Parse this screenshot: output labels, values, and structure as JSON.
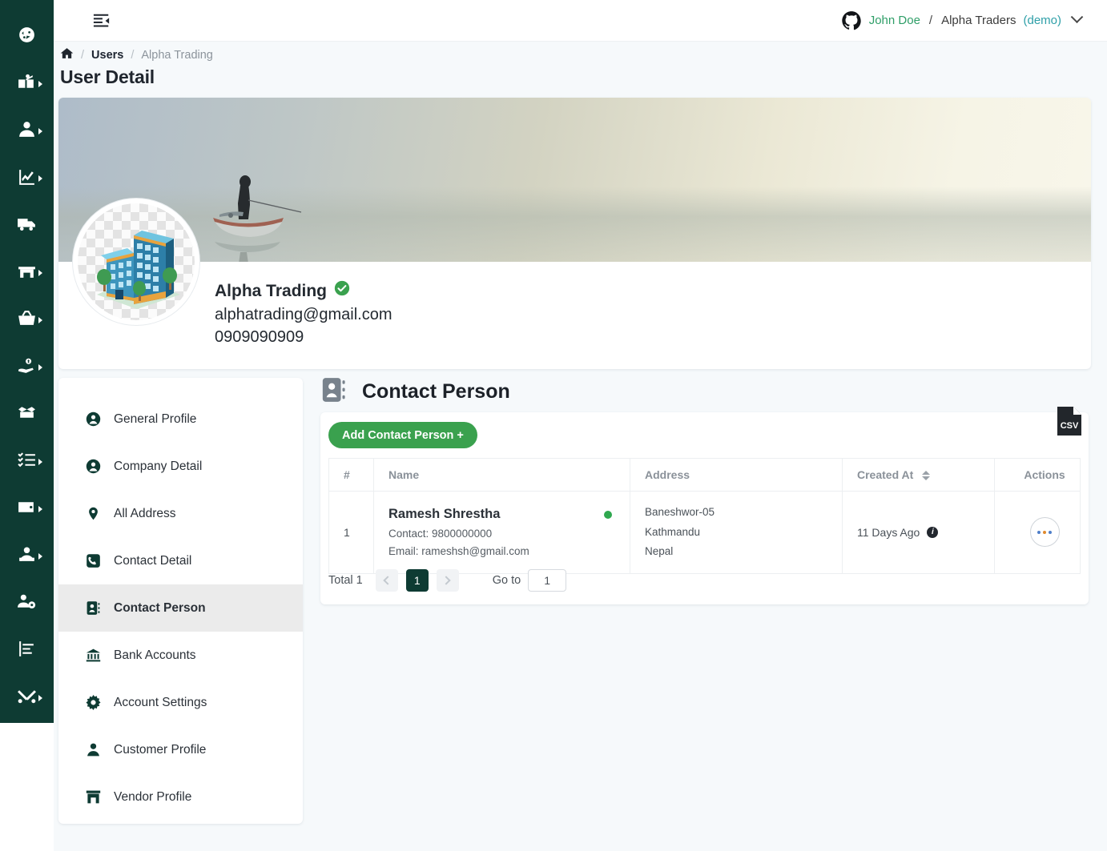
{
  "sidebar": {
    "items": [
      {
        "icon": "dashboard-icon",
        "caret": false
      },
      {
        "icon": "book-reader-icon",
        "caret": true
      },
      {
        "icon": "user-icon",
        "caret": true
      },
      {
        "icon": "chart-line-icon",
        "caret": true
      },
      {
        "icon": "truck-icon",
        "caret": false
      },
      {
        "icon": "store-icon",
        "caret": true
      },
      {
        "icon": "basket-icon",
        "caret": true
      },
      {
        "icon": "hand-money-icon",
        "caret": true
      },
      {
        "icon": "box-open-icon",
        "caret": false
      },
      {
        "icon": "task-list-icon",
        "caret": true
      },
      {
        "icon": "wallet-icon",
        "caret": true
      },
      {
        "icon": "users-group-icon",
        "caret": true
      },
      {
        "icon": "user-cog-icon",
        "caret": false
      },
      {
        "icon": "bar-report-icon",
        "caret": false
      },
      {
        "icon": "tools-icon",
        "caret": true
      }
    ]
  },
  "topbar": {
    "toggle_icon": "sidebar-collapse-icon",
    "account_icon": "github-avatar-icon",
    "user_name": "John Doe",
    "separator": "/",
    "org_name": "Alpha Traders",
    "org_mode": "(demo)",
    "dropdown_icon": "chevron-down-icon"
  },
  "breadcrumb": {
    "home_icon": "home-icon",
    "sep": "/",
    "items": [
      {
        "label": "Users",
        "current": false
      },
      {
        "label": "Alpha Trading",
        "current": true
      }
    ]
  },
  "page": {
    "title": "User Detail"
  },
  "profile": {
    "cover_alt": "fisherman-on-lake-cover",
    "avatar_alt": "company-building-avatar",
    "name": "Alpha Trading",
    "verified_icon": "verified-check-icon",
    "email": "alphatrading@gmail.com",
    "phone": "0909090909"
  },
  "menu": {
    "items": [
      {
        "label": "General Profile",
        "icon": "user-circle-icon",
        "active": false
      },
      {
        "label": "Company Detail",
        "icon": "user-circle-icon",
        "active": false
      },
      {
        "label": "All Address",
        "icon": "map-pin-icon",
        "active": false
      },
      {
        "label": "Contact Detail",
        "icon": "phone-square-icon",
        "active": false
      },
      {
        "label": "Contact Person",
        "icon": "address-book-icon",
        "active": true
      },
      {
        "label": "Bank Accounts",
        "icon": "bank-icon",
        "active": false
      },
      {
        "label": "Account Settings",
        "icon": "gear-icon",
        "active": false
      },
      {
        "label": "Customer Profile",
        "icon": "person-icon",
        "active": false
      },
      {
        "label": "Vendor Profile",
        "icon": "store-front-icon",
        "active": false
      }
    ]
  },
  "panel": {
    "icon": "address-book-icon",
    "title": "Contact Person",
    "add_button": "Add Contact Person +",
    "export_icon": "csv-file-icon",
    "columns": [
      "#",
      "Name",
      "Address",
      "Created At",
      "Actions"
    ],
    "sort_column": "Created At",
    "sort_icon": "sort-updown-icon",
    "rows": [
      {
        "index": "1",
        "name": "Ramesh Shrestha",
        "status_icon": "status-dot-active",
        "contact": "Contact: 9800000000",
        "email": "Email: rameshsh@gmail.com",
        "address_line1": "Baneshwor-05",
        "address_line2": "Kathmandu",
        "address_line3": "Nepal",
        "created_at": "11 Days Ago",
        "created_info_icon": "info-icon",
        "action_icon": "ellipsis-icon"
      }
    ],
    "pagination": {
      "total": "Total 1",
      "prev_icon": "chevron-left-icon",
      "current_page": "1",
      "next_icon": "chevron-right-icon",
      "goto_label": "Go to",
      "goto_value": "1"
    }
  },
  "colors": {
    "rail_bg": "#0e3b33",
    "accent_green": "#3aa14e",
    "user_green": "#2f9e68",
    "demo_teal": "#2e9fa8",
    "page_bg": "#f6f9fb",
    "active_menu_bg": "#ebebeb",
    "status_dot": "#2fa84f"
  }
}
